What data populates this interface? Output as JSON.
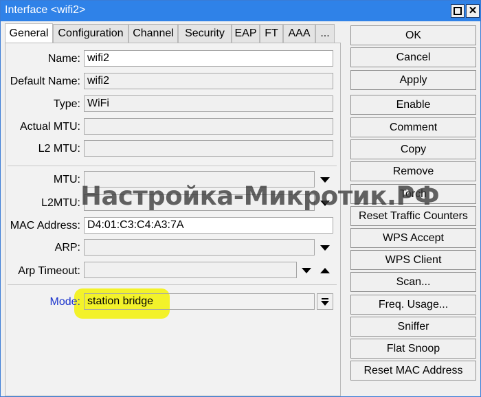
{
  "window": {
    "title": "Interface <wifi2>",
    "close_glyph": "✕"
  },
  "tabs": [
    {
      "label": "General"
    },
    {
      "label": "Configuration"
    },
    {
      "label": "Channel"
    },
    {
      "label": "Security"
    },
    {
      "label": "EAP"
    },
    {
      "label": "FT"
    },
    {
      "label": "AAA"
    },
    {
      "label": "..."
    }
  ],
  "form": {
    "name": {
      "label": "Name:",
      "value": "wifi2"
    },
    "default_name": {
      "label": "Default Name:",
      "value": "wifi2"
    },
    "type": {
      "label": "Type:",
      "value": "WiFi"
    },
    "actual_mtu": {
      "label": "Actual MTU:",
      "value": ""
    },
    "l2_mtu": {
      "label": "L2 MTU:",
      "value": ""
    },
    "mtu": {
      "label": "MTU:",
      "value": ""
    },
    "l2mtu": {
      "label": "L2MTU:",
      "value": ""
    },
    "mac_address": {
      "label": "MAC Address:",
      "value": "D4:01:C3:C4:A3:7A"
    },
    "arp": {
      "label": "ARP:",
      "value": ""
    },
    "arp_timeout": {
      "label": "Arp Timeout:",
      "value": ""
    },
    "mode": {
      "label": "Mode:",
      "value": "station bridge"
    }
  },
  "buttons": {
    "ok": "OK",
    "cancel": "Cancel",
    "apply": "Apply",
    "enable": "Enable",
    "comment": "Comment",
    "copy": "Copy",
    "remove": "Remove",
    "torch": "Torch",
    "reset_traffic_counters": "Reset Traffic Counters",
    "wps_accept": "WPS Accept",
    "wps_client": "WPS Client",
    "scan": "Scan...",
    "freq_usage": "Freq. Usage...",
    "sniffer": "Sniffer",
    "flat_snoop": "Flat Snoop",
    "reset_mac_address": "Reset MAC Address"
  },
  "watermark": "Настройка-Микротик.РФ",
  "colors": {
    "titlebar": "#2f82e8",
    "mode_label": "#1a33cc",
    "highlight": "#f3f22a"
  },
  "icons": [
    "maximize-icon",
    "close-icon",
    "dropdown-arrow-icon",
    "up-arrow-icon",
    "select-dropdown-icon"
  ]
}
